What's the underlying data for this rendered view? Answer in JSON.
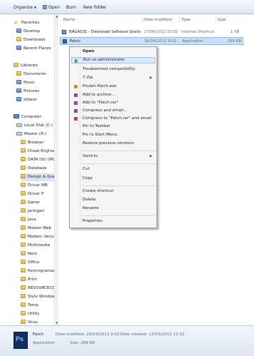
{
  "toolbar": {
    "organize": "Organize",
    "open": "Open",
    "burn": "Burn",
    "new_folder": "New folder"
  },
  "nav": {
    "favorites": "Favorites",
    "desktop": "Desktop",
    "downloads": "Downloads",
    "recent": "Recent Places",
    "libraries": "Libraries",
    "documents": "Documents",
    "music": "Music",
    "pictures": "Pictures",
    "videos": "Videos",
    "computer": "Computer",
    "local_disk": "Local Disk (C:)",
    "master": "Master (D:)",
    "folders": [
      "Browser",
      "Cheat Engine 6",
      "DATA ISO (IMA",
      "Database",
      "Design & Grafis",
      "Driver MB",
      "Driver P",
      "Game",
      "Jaringan",
      "Java",
      "Master Web",
      "Modem Venus",
      "Multimedia",
      "Nero",
      "Office",
      "Pemrograman",
      "Print",
      "RESOURCECD (",
      "Style Windows",
      "Temp",
      "Utility",
      "Virus"
    ]
  },
  "columns": {
    "name": "Name",
    "date": "Date modified",
    "type": "Type",
    "size": "Size"
  },
  "files": [
    {
      "name": "BAGAS31 - Download Software Gratis",
      "date": "27/06/2012 10:02",
      "type": "Internet Shortcut",
      "size": "1 KB"
    },
    {
      "name": "Patch",
      "date": "26/04/2012 9:02",
      "type": "Application",
      "size": "289 KB"
    }
  ],
  "menu": {
    "open": "Open",
    "run_admin": "Run as administrator",
    "troubleshoot": "Troubleshoot compatibility",
    "zip": "7-Zip",
    "pindah": "Pindah Patch.exe",
    "add_archive": "Add to archive...",
    "add_rar": "Add to \"Patch.rar\"",
    "compress_email": "Compress and email...",
    "compress_rar_email": "Compress to \"Patch.rar\" and email",
    "pin_taskbar": "Pin to Taskbar",
    "pin_start": "Pin to Start Menu",
    "restore": "Restore previous versions",
    "send_to": "Send to",
    "cut": "Cut",
    "copy": "Copy",
    "create_shortcut": "Create shortcut",
    "delete": "Delete",
    "rename": "Rename",
    "properties": "Properties"
  },
  "details": {
    "name": "Patch",
    "type": "Application",
    "date_modified": "Date modified: 26/04/2012 9:02",
    "size": "Size: 289 KB",
    "date_created": "Date created: 12/03/2013 10:32"
  },
  "icons": {
    "app_icon_text": "Ps"
  }
}
